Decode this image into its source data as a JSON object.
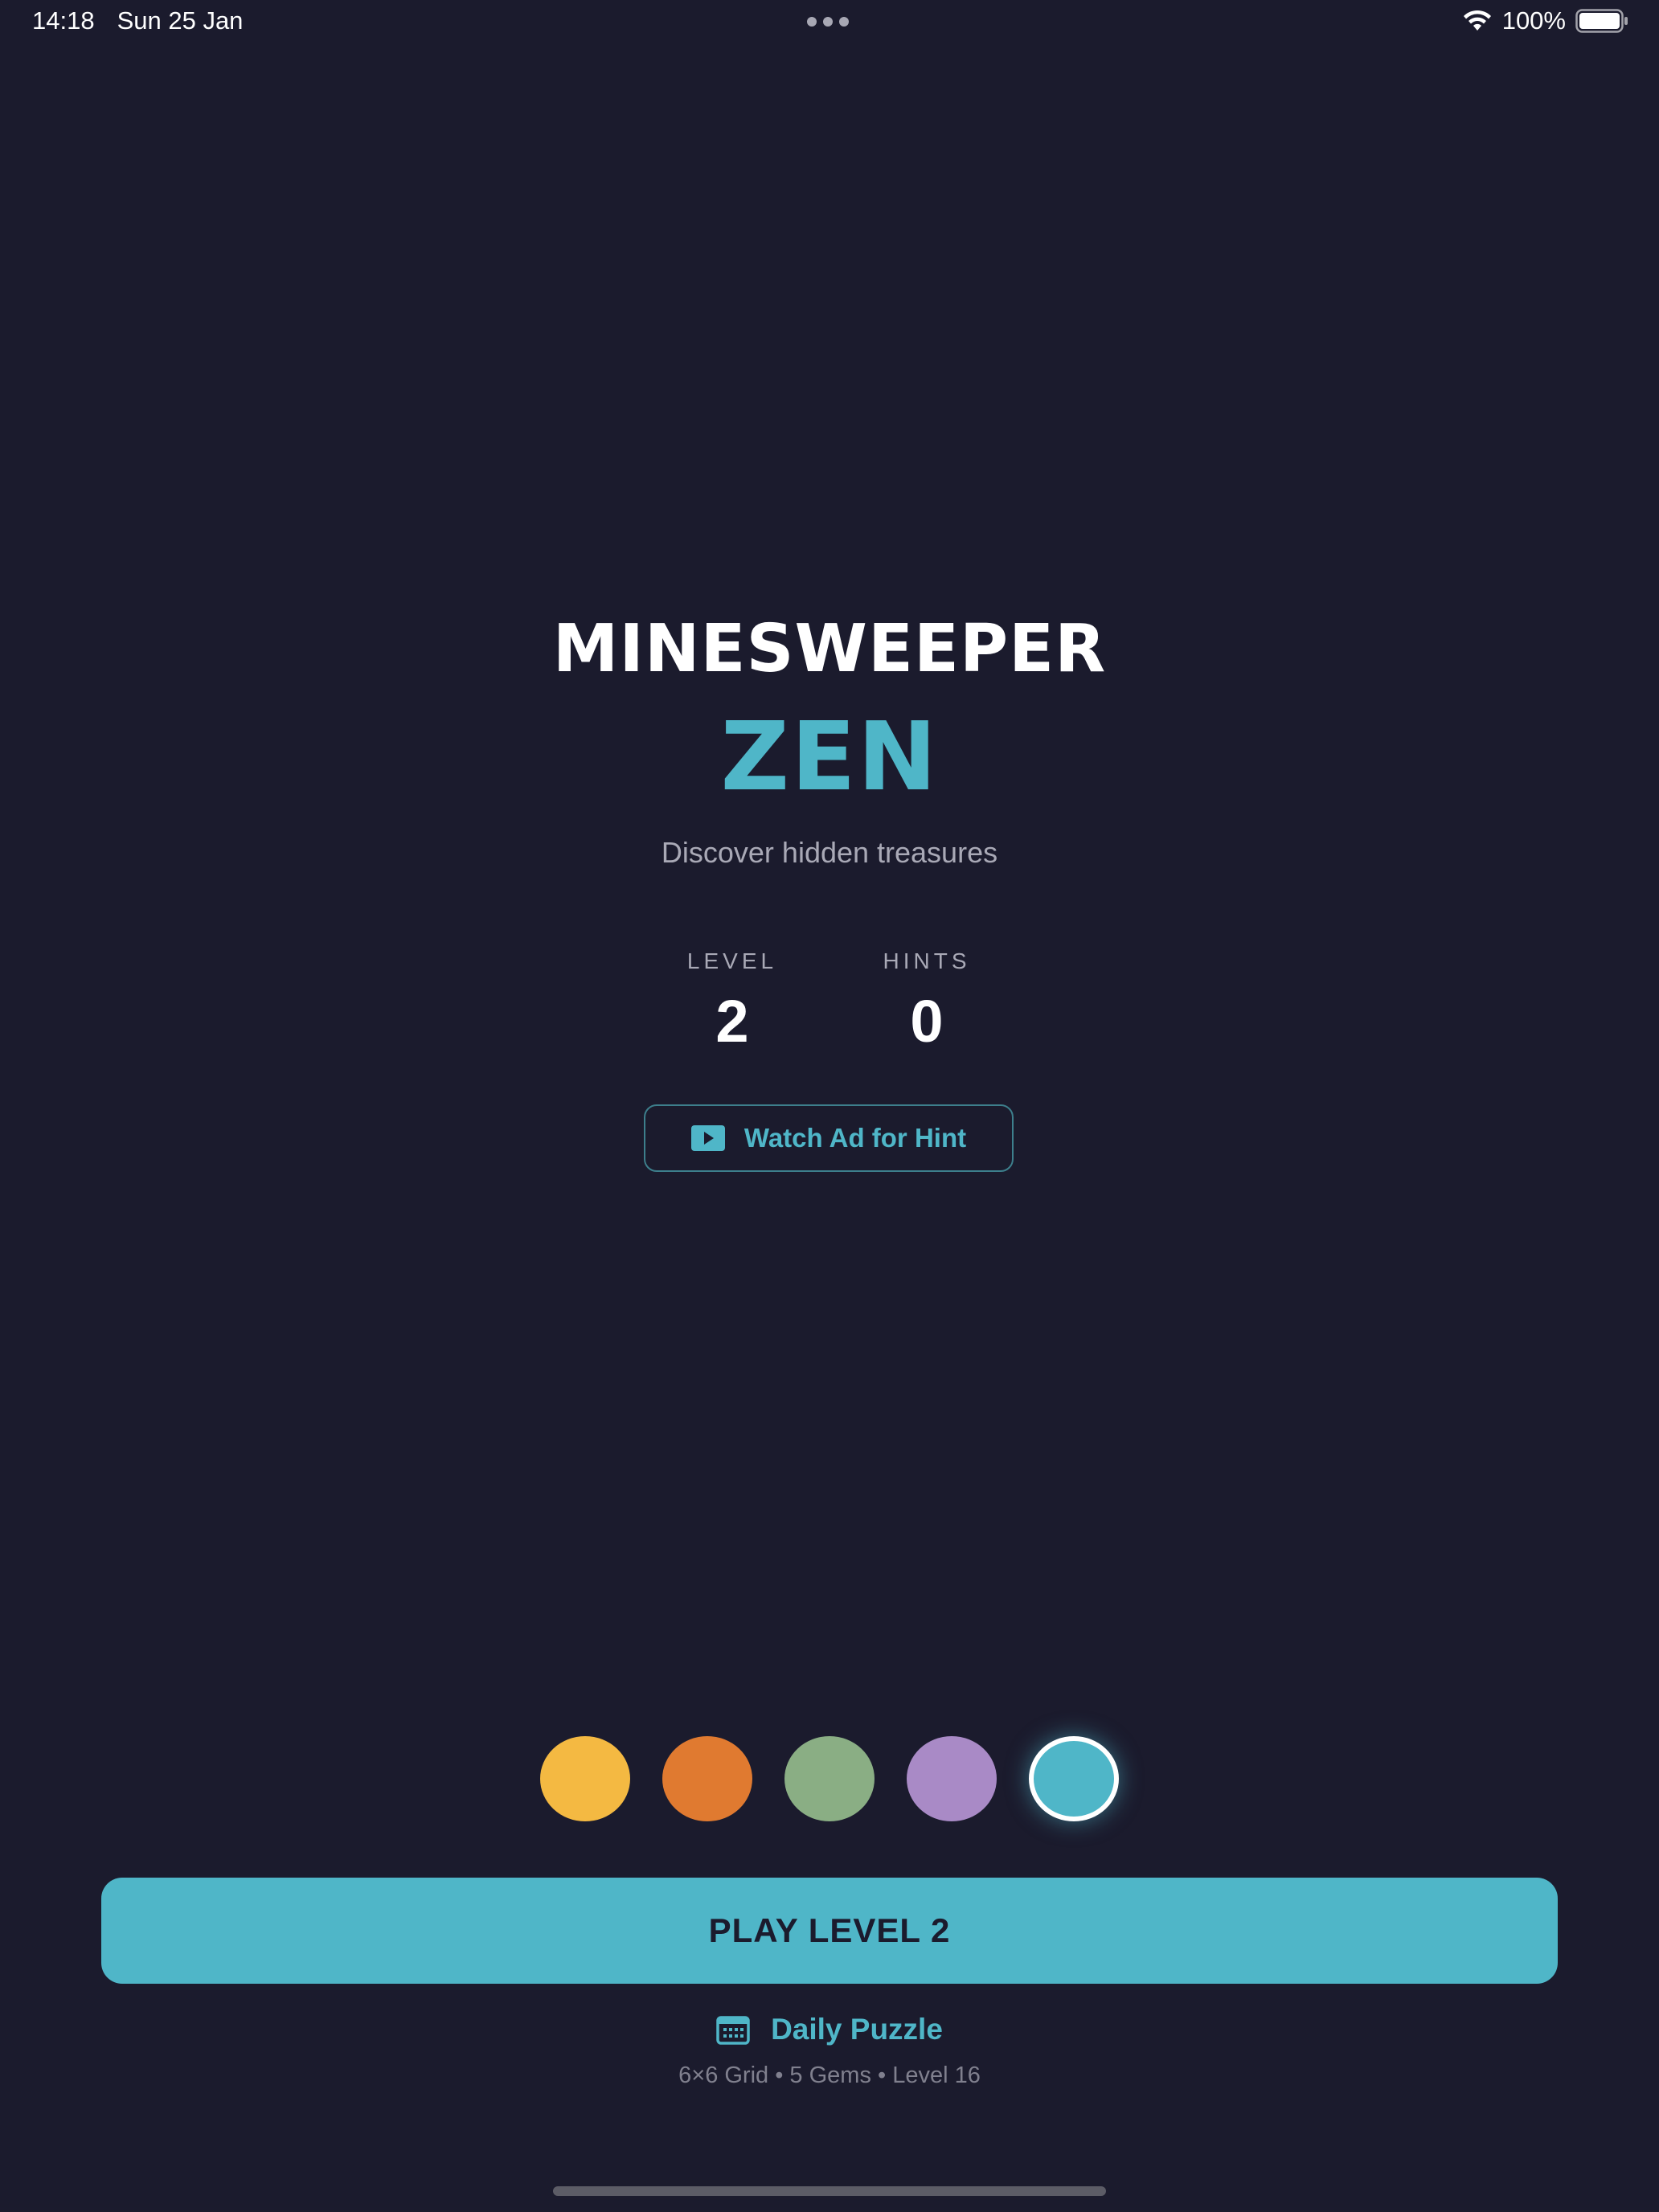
{
  "status_bar": {
    "time": "14:18",
    "date": "Sun 25 Jan",
    "battery_text": "100%",
    "icons": [
      "wifi-icon",
      "battery-icon"
    ]
  },
  "header": {
    "title": "MINESWEEPER",
    "subtitle": "ZEN",
    "tagline": "Discover hidden treasures"
  },
  "stats": {
    "level_label": "LEVEL",
    "level_value": "2",
    "hints_label": "HINTS",
    "hints_value": "0"
  },
  "ad_button": {
    "label": "Watch Ad for Hint",
    "icon": "play-video-icon"
  },
  "theme_swatches": [
    {
      "color": "#f4b942",
      "selected": false
    },
    {
      "color": "#e07a30",
      "selected": false
    },
    {
      "color": "#8aae84",
      "selected": false
    },
    {
      "color": "#a98ac6",
      "selected": false
    },
    {
      "color": "#4fb6c8",
      "selected": true
    }
  ],
  "play_button": {
    "label": "PLAY LEVEL 2"
  },
  "daily_puzzle": {
    "label": "Daily Puzzle",
    "icon": "calendar-icon",
    "info": "6×6 Grid • 5 Gems • Level 16"
  },
  "colors": {
    "background": "#1b1b2d",
    "accent": "#4fb6c8",
    "muted_text": "#a9a9b6"
  }
}
